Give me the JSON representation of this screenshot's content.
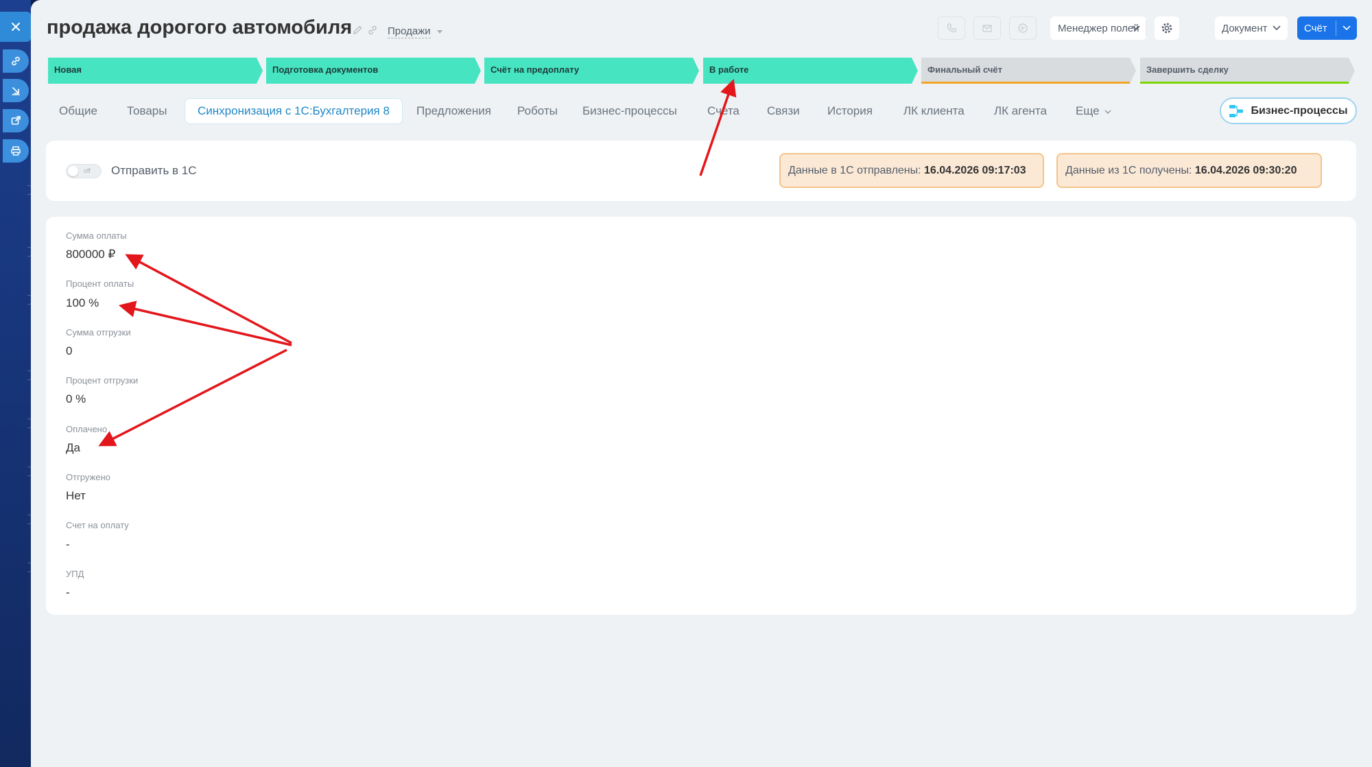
{
  "deal": {
    "title": "продажа дорогого автомобиля",
    "category": "Продажи"
  },
  "toolbar": {
    "field_manager": "Менеджер полей",
    "document": "Документ",
    "invoice": "Счёт"
  },
  "stages": [
    {
      "label": "Новая",
      "state": "active",
      "color": "#47e4c2"
    },
    {
      "label": "Подготовка документов",
      "state": "active",
      "color": "#47e4c2"
    },
    {
      "label": "Счёт на предоплату",
      "state": "active",
      "color": "#47e4c2"
    },
    {
      "label": "В работе",
      "state": "active",
      "color": "#47e4c2"
    },
    {
      "label": "Финальный счёт",
      "state": "idle",
      "underline": "#f2a623"
    },
    {
      "label": "Завершить сделку",
      "state": "idle",
      "underline": "#7bd500"
    }
  ],
  "tabs": [
    {
      "label": "Общие"
    },
    {
      "label": "Товары"
    },
    {
      "label": "Синхронизация с 1С:Бухгалтерия 8",
      "active": true
    },
    {
      "label": "Предложения"
    },
    {
      "label": "Роботы"
    },
    {
      "label": "Бизнес-процессы"
    },
    {
      "label": "Счета"
    },
    {
      "label": "Связи"
    },
    {
      "label": "История"
    },
    {
      "label": "ЛК клиента"
    },
    {
      "label": "ЛК агента"
    },
    {
      "label": "Еще"
    }
  ],
  "bp_button": "Бизнес-процессы",
  "sync": {
    "toggle_state": "off",
    "send_label": "Отправить в 1С",
    "sent_label": "Данные в 1С отправлены:",
    "sent_time": "16.04.2026 09:17:03",
    "received_label": "Данные из 1С получены:",
    "received_time": "16.04.2026 09:30:20"
  },
  "fields": [
    {
      "label": "Сумма оплаты",
      "value": "800000 ₽"
    },
    {
      "label": "Процент оплаты",
      "value": "100 %"
    },
    {
      "label": "Сумма отгрузки",
      "value": "0"
    },
    {
      "label": "Процент отгрузки",
      "value": "0 %"
    },
    {
      "label": "Оплачено",
      "value": "Да"
    },
    {
      "label": "Отгружено",
      "value": "Нет"
    },
    {
      "label": "Счет на оплату",
      "value": "-"
    },
    {
      "label": "УПД",
      "value": "-"
    }
  ],
  "colors": {
    "accent": "#2fc6f6",
    "primary_button": "#1a73e8",
    "stage_active": "#47e4c2",
    "annotation_arrow": "#e3161b"
  },
  "icons": {
    "rail": [
      "close-icon",
      "link-icon",
      "download-icon",
      "external-link-icon",
      "print-icon"
    ],
    "title": [
      "pencil-icon",
      "link-icon"
    ],
    "toolbar": [
      "phone-icon",
      "mail-icon",
      "chat-icon",
      "gear-icon",
      "chevron-down-icon"
    ],
    "bp_button": "business-process-icon"
  }
}
